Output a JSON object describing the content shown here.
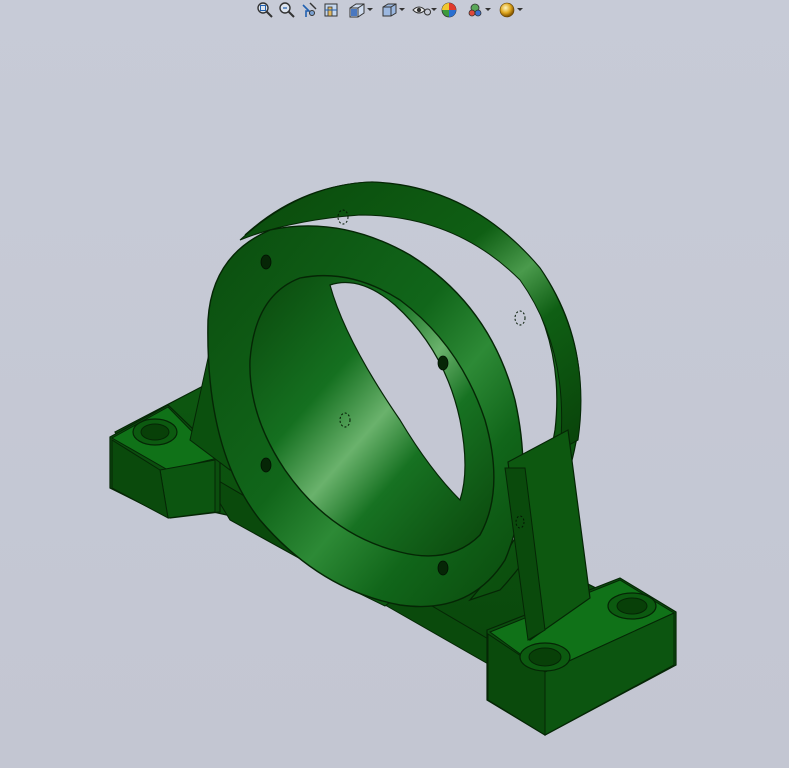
{
  "toolbar": {
    "buttons": [
      {
        "icon": "zoom-to-fit-icon",
        "has_dropdown": false
      },
      {
        "icon": "zoom-to-area-icon",
        "has_dropdown": false
      },
      {
        "icon": "previous-view-icon",
        "has_dropdown": false
      },
      {
        "icon": "section-view-icon",
        "has_dropdown": false
      },
      {
        "icon": "view-orientation-icon",
        "has_dropdown": true
      },
      {
        "icon": "display-style-icon",
        "has_dropdown": true
      },
      {
        "icon": "hide-show-items-icon",
        "has_dropdown": true
      },
      {
        "icon": "edit-appearance-icon",
        "has_dropdown": false
      },
      {
        "icon": "apply-scene-icon",
        "has_dropdown": true
      },
      {
        "icon": "view-settings-icon",
        "has_dropdown": true
      }
    ]
  },
  "model": {
    "name": "",
    "color": "#0e5a12",
    "highlight": "#5faa5f",
    "edge": "#062806"
  },
  "colors": {
    "background_top": "#c7cbd7",
    "background_bottom": "#c3c6d2"
  }
}
